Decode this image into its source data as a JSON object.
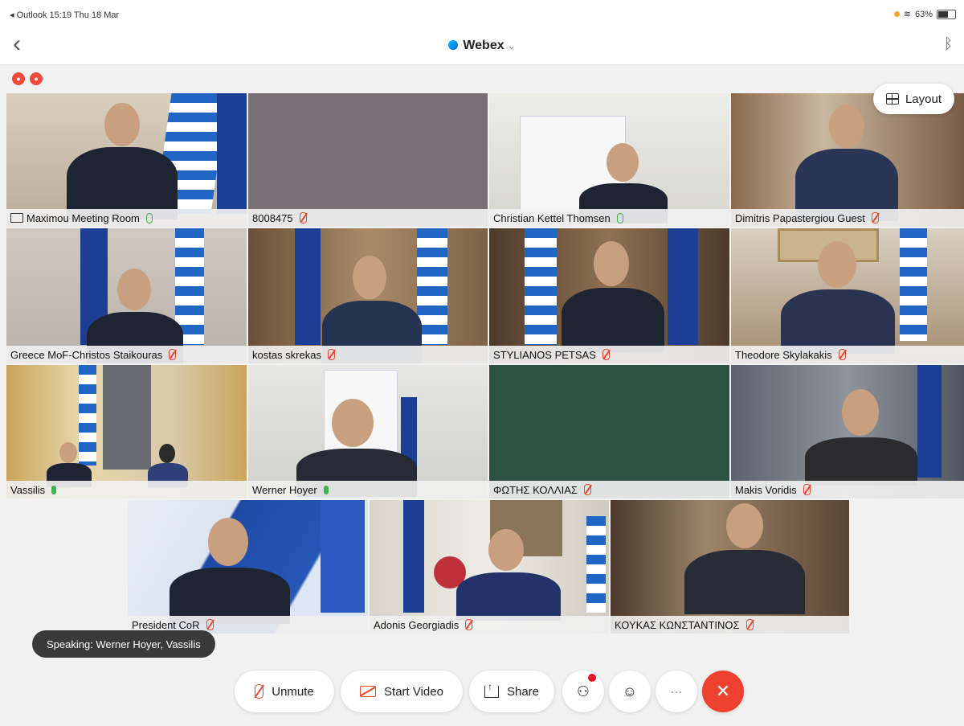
{
  "status_bar": {
    "left": "◂ Outlook  15:19  Thu 18 Mar",
    "right": "63%"
  },
  "app": {
    "title": "Webex",
    "title_chevron": "chevron-down",
    "back_icon": "chevron-left-icon",
    "bluetooth_icon": "bluetooth-icon"
  },
  "recording_indicators": [
    "red-dot",
    "red-dot"
  ],
  "layout_button": {
    "label": "Layout"
  },
  "participants": [
    {
      "name": "Maximou Meeting Room",
      "mic": "on-outline",
      "room": true
    },
    {
      "name": "8008475",
      "mic": "muted"
    },
    {
      "name": "Christian Kettel Thomsen",
      "mic": "on-outline"
    },
    {
      "name": "Dimitris Papastergiou Guest",
      "mic": "muted"
    },
    {
      "name": "Greece MoF-Christos Staikouras",
      "mic": "muted"
    },
    {
      "name": "kostas skrekas",
      "mic": "muted"
    },
    {
      "name": "STYLIANOS PETSAS",
      "mic": "muted",
      "active": true
    },
    {
      "name": "Theodore Skylakakis",
      "mic": "muted"
    },
    {
      "name": "Vassilis",
      "mic": "on"
    },
    {
      "name": "Werner Hoyer",
      "mic": "on"
    },
    {
      "name": "ΦΩΤΗΣ ΚΟΛΛΙΑΣ",
      "mic": "muted"
    },
    {
      "name": "Makis Voridis",
      "mic": "muted"
    },
    {
      "name": "President CoR",
      "mic": "muted"
    },
    {
      "name": "Adonis Georgiadis",
      "mic": "muted"
    },
    {
      "name": "ΚΟΥΚΑΣ ΚΩΝΣΤΑΝΤΙΝΟΣ",
      "mic": "muted"
    }
  ],
  "speaking": "Speaking: Werner Hoyer, Vassilis",
  "toolbar": {
    "unmute_label": "Unmute",
    "start_video_label": "Start Video",
    "share_label": "Share",
    "participants_icon": "participants-icon",
    "reactions_icon": "smiley-icon",
    "more_label": "···",
    "end_label": "✕"
  },
  "colors": {
    "accent_red": "#ef4130",
    "mic_on": "#3fb34f",
    "active_speaker_border": "#1ba2b3",
    "webex_blue": "#0065d9"
  }
}
